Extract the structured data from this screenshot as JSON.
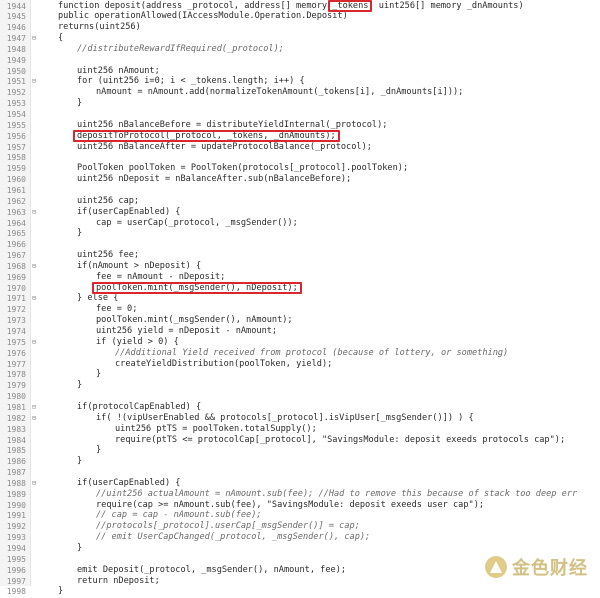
{
  "code_lines": [
    {
      "n": "1944",
      "fold": "",
      "indent": 0,
      "text": "function deposit(address _protocol, address[] memory _tokens, uint256[] memory _dnAmounts)",
      "style": "code"
    },
    {
      "n": "1945",
      "fold": "",
      "indent": 0,
      "text": "public operationAllowed(IAccessModule.Operation.Deposit)",
      "style": "code"
    },
    {
      "n": "1946",
      "fold": "",
      "indent": 0,
      "text": "returns(uint256)",
      "style": "code"
    },
    {
      "n": "1947",
      "fold": "⊟",
      "indent": 0,
      "text": "{",
      "style": "code"
    },
    {
      "n": "1948",
      "fold": "",
      "indent": 1,
      "text": "//distributeRewardIfRequired(_protocol);",
      "style": "comment"
    },
    {
      "n": "1949",
      "fold": "",
      "indent": 0,
      "text": "",
      "style": "code"
    },
    {
      "n": "1950",
      "fold": "",
      "indent": 1,
      "text": "uint256 nAmount;",
      "style": "code"
    },
    {
      "n": "1951",
      "fold": "⊟",
      "indent": 1,
      "text": "for (uint256 i=0; i < _tokens.length; i++) {",
      "style": "code"
    },
    {
      "n": "1952",
      "fold": "",
      "indent": 2,
      "text": "nAmount = nAmount.add(normalizeTokenAmount(_tokens[i], _dnAmounts[i]));",
      "style": "code"
    },
    {
      "n": "1953",
      "fold": "",
      "indent": 1,
      "text": "}",
      "style": "code"
    },
    {
      "n": "1954",
      "fold": "",
      "indent": 0,
      "text": "",
      "style": "code"
    },
    {
      "n": "1955",
      "fold": "",
      "indent": 1,
      "text": "uint256 nBalanceBefore = distributeYieldInternal(_protocol);",
      "style": "code"
    },
    {
      "n": "1956",
      "fold": "",
      "indent": 1,
      "text": "depositToProtocol(_protocol, _tokens, _dnAmounts);",
      "style": "code"
    },
    {
      "n": "1957",
      "fold": "",
      "indent": 1,
      "text": "uint256 nBalanceAfter = updateProtocolBalance(_protocol);",
      "style": "code"
    },
    {
      "n": "1958",
      "fold": "",
      "indent": 0,
      "text": "",
      "style": "code"
    },
    {
      "n": "1959",
      "fold": "",
      "indent": 1,
      "text": "PoolToken poolToken = PoolToken(protocols[_protocol].poolToken);",
      "style": "code"
    },
    {
      "n": "1960",
      "fold": "",
      "indent": 1,
      "text": "uint256 nDeposit = nBalanceAfter.sub(nBalanceBefore);",
      "style": "code"
    },
    {
      "n": "1961",
      "fold": "",
      "indent": 0,
      "text": "",
      "style": "code"
    },
    {
      "n": "1962",
      "fold": "",
      "indent": 1,
      "text": "uint256 cap;",
      "style": "code"
    },
    {
      "n": "1963",
      "fold": "⊟",
      "indent": 1,
      "text": "if(userCapEnabled) {",
      "style": "code"
    },
    {
      "n": "1964",
      "fold": "",
      "indent": 2,
      "text": "cap = userCap(_protocol, _msgSender());",
      "style": "code"
    },
    {
      "n": "1965",
      "fold": "",
      "indent": 1,
      "text": "}",
      "style": "code"
    },
    {
      "n": "1966",
      "fold": "",
      "indent": 0,
      "text": "",
      "style": "code"
    },
    {
      "n": "1967",
      "fold": "",
      "indent": 1,
      "text": "uint256 fee;",
      "style": "code"
    },
    {
      "n": "1968",
      "fold": "⊟",
      "indent": 1,
      "text": "if(nAmount > nDeposit) {",
      "style": "code"
    },
    {
      "n": "1969",
      "fold": "",
      "indent": 2,
      "text": "fee = nAmount - nDeposit;",
      "style": "code"
    },
    {
      "n": "1970",
      "fold": "",
      "indent": 2,
      "text": "poolToken.mint(_msgSender(), nDeposit);",
      "style": "code"
    },
    {
      "n": "1971",
      "fold": "⊟",
      "indent": 1,
      "text": "} else {",
      "style": "code"
    },
    {
      "n": "1972",
      "fold": "",
      "indent": 2,
      "text": "fee = 0;",
      "style": "code"
    },
    {
      "n": "1973",
      "fold": "",
      "indent": 2,
      "text": "poolToken.mint(_msgSender(), nAmount);",
      "style": "code"
    },
    {
      "n": "1974",
      "fold": "",
      "indent": 2,
      "text": "uint256 yield = nDeposit - nAmount;",
      "style": "code"
    },
    {
      "n": "1975",
      "fold": "⊟",
      "indent": 2,
      "text": "if (yield > 0) {",
      "style": "code"
    },
    {
      "n": "1976",
      "fold": "",
      "indent": 3,
      "text": "//Additional Yield received from protocol (because of lottery, or something)",
      "style": "comment"
    },
    {
      "n": "1977",
      "fold": "",
      "indent": 3,
      "text": "createYieldDistribution(poolToken, yield);",
      "style": "code"
    },
    {
      "n": "1978",
      "fold": "",
      "indent": 2,
      "text": "}",
      "style": "code"
    },
    {
      "n": "1979",
      "fold": "",
      "indent": 1,
      "text": "}",
      "style": "code"
    },
    {
      "n": "1980",
      "fold": "",
      "indent": 0,
      "text": "",
      "style": "code"
    },
    {
      "n": "1981",
      "fold": "⊟",
      "indent": 1,
      "text": "if(protocolCapEnabled) {",
      "style": "code"
    },
    {
      "n": "1982",
      "fold": "⊟",
      "indent": 2,
      "text": "if( !(vipUserEnabled && protocols[_protocol].isVipUser[_msgSender()]) ) {",
      "style": "code"
    },
    {
      "n": "1983",
      "fold": "",
      "indent": 3,
      "text": "uint256 ptTS = poolToken.totalSupply();",
      "style": "code"
    },
    {
      "n": "1984",
      "fold": "",
      "indent": 3,
      "text": "require(ptTS <= protocolCap[_protocol], \"SavingsModule: deposit exeeds protocols cap\");",
      "style": "code"
    },
    {
      "n": "1985",
      "fold": "",
      "indent": 2,
      "text": "}",
      "style": "code"
    },
    {
      "n": "1986",
      "fold": "",
      "indent": 1,
      "text": "}",
      "style": "code"
    },
    {
      "n": "1987",
      "fold": "",
      "indent": 0,
      "text": "",
      "style": "code"
    },
    {
      "n": "1988",
      "fold": "⊟",
      "indent": 1,
      "text": "if(userCapEnabled) {",
      "style": "code"
    },
    {
      "n": "1989",
      "fold": "",
      "indent": 2,
      "text": "//uint256 actualAmount = nAmount.sub(fee); //Had to remove this because of stack too deep err",
      "style": "comment"
    },
    {
      "n": "1990",
      "fold": "",
      "indent": 2,
      "text": "require(cap >= nAmount.sub(fee), \"SavingsModule: deposit exeeds user cap\");",
      "style": "code"
    },
    {
      "n": "1991",
      "fold": "",
      "indent": 2,
      "text": "// cap = cap - nAmount.sub(fee);",
      "style": "comment"
    },
    {
      "n": "1992",
      "fold": "",
      "indent": 2,
      "text": "//protocols[_protocol].userCap[_msgSender()] = cap;",
      "style": "comment"
    },
    {
      "n": "1993",
      "fold": "",
      "indent": 2,
      "text": "// emit UserCapChanged(_protocol, _msgSender(), cap);",
      "style": "comment"
    },
    {
      "n": "1994",
      "fold": "",
      "indent": 1,
      "text": "}",
      "style": "code"
    },
    {
      "n": "1995",
      "fold": "",
      "indent": 0,
      "text": "",
      "style": "code"
    },
    {
      "n": "1996",
      "fold": "",
      "indent": 1,
      "text": "emit Deposit(_protocol, _msgSender(), nAmount, fee);",
      "style": "code"
    },
    {
      "n": "1997",
      "fold": "",
      "indent": 1,
      "text": "return nDeposit;",
      "style": "code"
    },
    {
      "n": "1998",
      "fold": "",
      "indent": 0,
      "text": "}",
      "style": "code"
    }
  ],
  "highlights": [
    {
      "name": "highlight-tokens-param",
      "line": 0,
      "text": "_tokens"
    },
    {
      "name": "highlight-deposit-to-protocol",
      "line": 12,
      "text": "depositToProtocol(_protocol, _tokens, _dnAmounts);"
    },
    {
      "name": "highlight-pooltoken-mint",
      "line": 26,
      "text": "poolToken.mint(_msgSender(), nDeposit);"
    }
  ],
  "watermark": {
    "text": "金色财经",
    "logo_icon": "jinse-logo-icon"
  },
  "colors": {
    "highlight_box": "#d9272e",
    "comment": "#6a6a6a",
    "code": "#2b2b2b",
    "line_number": "#8a8a8a"
  }
}
